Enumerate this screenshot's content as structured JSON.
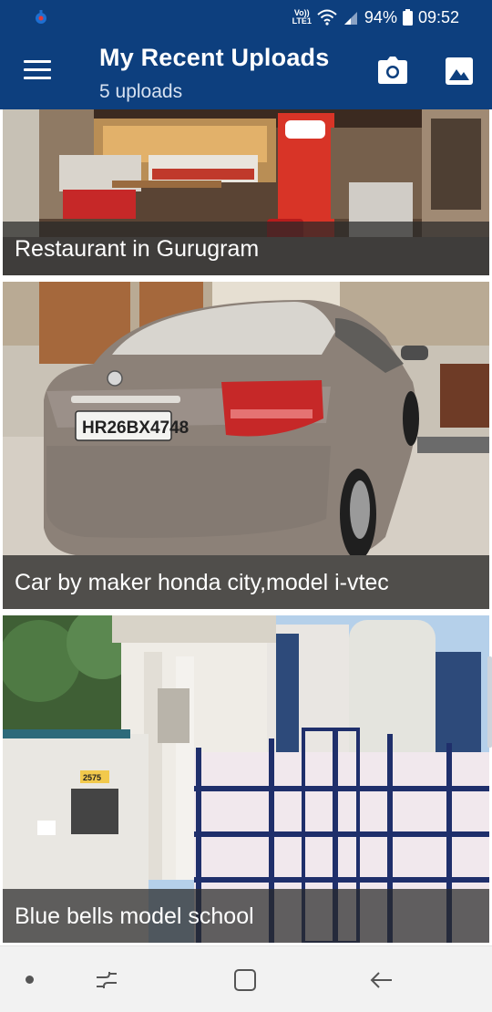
{
  "status_bar": {
    "volte_line1": "Vo))",
    "volte_line2": "LTE1",
    "battery": "94%",
    "time": "09:52",
    "left_icon": "app-notification-icon"
  },
  "app_bar": {
    "title": "My Recent Uploads",
    "subtitle": "5 uploads",
    "menu_icon": "menu-icon",
    "camera_icon": "camera-icon",
    "gallery_icon": "image-icon",
    "background": "#0d3f7e"
  },
  "uploads": [
    {
      "caption": "Restaurant in Gurugram",
      "image": "restaurant storefront photo"
    },
    {
      "caption": "Car by maker honda city,model i-vtec",
      "image": "grey honda sedan rear photo",
      "plate_text": "HR26BX4748"
    },
    {
      "caption": "Blue bells model school",
      "image": "school building with blue gate photo",
      "sign_text": "2575"
    }
  ],
  "nav_bar": {
    "recents_icon": "recents-icon",
    "home_icon": "home-icon",
    "back_icon": "back-icon"
  }
}
